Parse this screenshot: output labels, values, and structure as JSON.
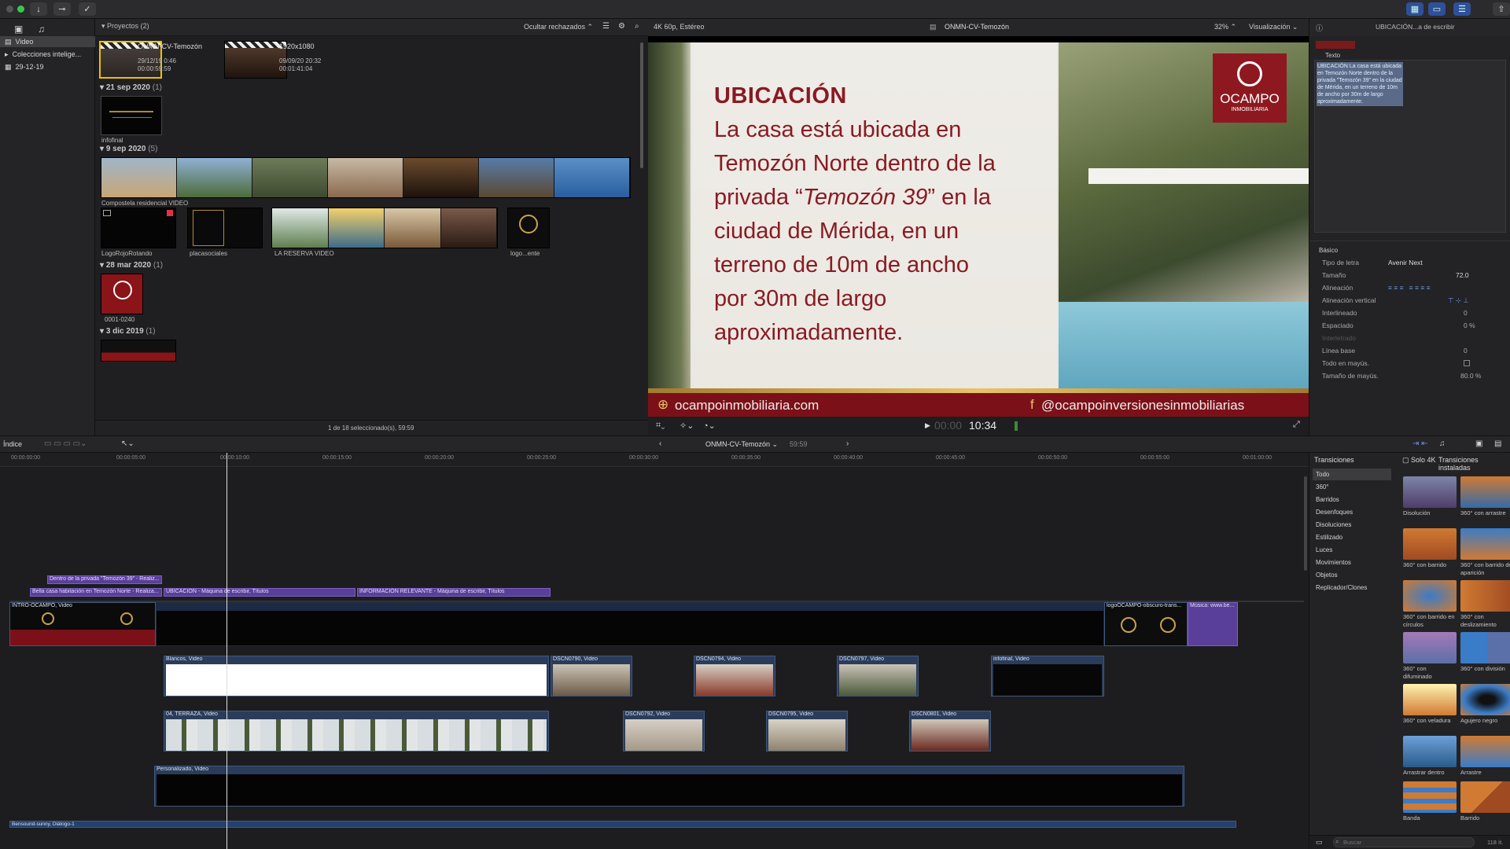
{
  "toolbar": {
    "title": "ONMN-CV-Temozón"
  },
  "sidebar": {
    "items": [
      {
        "label": "Video",
        "selected": true
      },
      {
        "label": "Colecciones intelige..."
      },
      {
        "label": "29-12-19"
      }
    ]
  },
  "browser": {
    "filter_label": "Ocultar rechazados",
    "project_group": "Proyectos",
    "project_count": "(2)",
    "projects": [
      {
        "name": "ONMN-CV-Temozón",
        "date": "29/12/19 0:46",
        "duration": "00:00:59:59"
      },
      {
        "name": "1920x1080",
        "date": "09/09/20 20:32",
        "duration": "00:01:41:04"
      }
    ],
    "groups": [
      {
        "date": "21 sep 2020",
        "count": "(1)",
        "clips": [
          {
            "name": "infofinal"
          }
        ]
      },
      {
        "date": "9 sep 2020",
        "count": "(5)",
        "clips": [
          {
            "name": "Compostela residencial VIDEO"
          },
          {
            "name": "LogoRojoRotando"
          },
          {
            "name": "placasociales"
          },
          {
            "name": "LA RESERVA VIDEO"
          },
          {
            "name": "logo...ente"
          }
        ]
      },
      {
        "date": "28 mar 2020",
        "count": "(1)",
        "clips": [
          {
            "name": "0001-0240"
          }
        ]
      },
      {
        "date": "3 dic 2019",
        "count": "(1)",
        "clips": []
      }
    ],
    "status": "1 de 18 seleccionado(s), 59:59"
  },
  "viewer": {
    "format": "4K 60p, Estéreo",
    "project": "ONMN-CV-Temozón",
    "zoom": "32%",
    "view_menu": "Visualización",
    "timecode_dim": "00:00",
    "timecode": "10:34",
    "frame": {
      "heading": "UBICACIÓN",
      "body_lines": [
        "La casa está ubicada en",
        "Temozón Norte dentro de la",
        "privada “",
        "Temozón 39",
        "” en la",
        "ciudad de Mérida, en un",
        "terreno de 10m de ancho",
        "por 30m de largo",
        "aproximadamente."
      ],
      "logo_word": "OCAMPO",
      "logo_sub": "INMOBILIARIA",
      "website": "ocampoinmobiliaria.com",
      "social": "@ocampoinversionesinmobiliarias"
    }
  },
  "inspector": {
    "header": "UBICACIÓN...a de escribir",
    "section_text": "Texto",
    "text_value": "UBICACIÓN La casa está ubicada en Temozón Norte dentro de la privada \"Temozón 39\" en la ciudad de Mérida, en un terreno de 10m de ancho por 30m de largo aproximadamente.",
    "section_basic": "Básico",
    "rows": [
      {
        "label": "Tipo de letra",
        "value": "Avenir Next"
      },
      {
        "label": "Tamaño",
        "value": "72.0"
      },
      {
        "label": "Alineación",
        "value": ""
      },
      {
        "label": "Alineación vertical",
        "value": ""
      },
      {
        "label": "Interlineado",
        "value": "0"
      },
      {
        "label": "Espaciado",
        "value": "0 %"
      },
      {
        "label": "Interletrado",
        "value": ""
      },
      {
        "label": "Línea base",
        "value": "0"
      },
      {
        "label": "Todo en mayús.",
        "value": ""
      },
      {
        "label": "Tamaño de mayús.",
        "value": "80.0 %"
      }
    ]
  },
  "timeline": {
    "index_label": "Índice",
    "project": "ONMN-CV-Temozón",
    "duration": "59:59",
    "ruler": [
      "00:00:00:00",
      "00:00:05:00",
      "00:00:10:00",
      "00:00:15:00",
      "00:00:20:00",
      "00:00:25:00",
      "00:00:30:00",
      "00:00:35:00",
      "00:00:40:00",
      "00:00:45:00",
      "00:00:50:00",
      "00:00:55:00",
      "00:01:00:00"
    ],
    "titles": [
      {
        "label": "Dentro de la privada \"Temozón 39\" - Realiz..."
      },
      {
        "label": "Bella casa habitación en Temozón Norte - Realiza..."
      },
      {
        "label": "UBICACIÓN - Máquina de escribir, Títulos"
      },
      {
        "label": "INFORMACIÓN RELEVANTE - Máquina de escribir, Títulos"
      }
    ],
    "primary": [
      {
        "label": "INTRO-OCAMPO, Video"
      },
      {
        "label": "logoOCAMPO-obscuro-trans..."
      },
      {
        "label": "Música: www.be..."
      }
    ],
    "conn1": [
      {
        "label": "Blancos, Video"
      },
      {
        "label": "DSCN0790, Video"
      },
      {
        "label": "DSCN0794, Video"
      },
      {
        "label": "DSCN0797, Video"
      },
      {
        "label": "infofinal, Video"
      }
    ],
    "conn2": [
      {
        "label": "04, TERRAZA, Video"
      },
      {
        "label": "DSCN0792, Video"
      },
      {
        "label": "DSCN0795, Video"
      },
      {
        "label": "DSCN0801, Video"
      }
    ],
    "lower": {
      "label": "Personalizado, Video"
    },
    "audio": {
      "label": "Bensound-sunny, Diálogo-1"
    }
  },
  "transitions": {
    "header": "Transiciones",
    "only_installed": "Solo 4K",
    "installed_label": "Transiciones instaladas",
    "categories": [
      "Todo",
      "360°",
      "Barridos",
      "Desenfoques",
      "Disoluciones",
      "Estilizado",
      "Luces",
      "Movimientos",
      "Objetos",
      "Replicador/Clones"
    ],
    "items": [
      {
        "name": "Disolución"
      },
      {
        "name": "360° con arrastre"
      },
      {
        "name": "360° con barrido"
      },
      {
        "name": "360° con barrido de aparición"
      },
      {
        "name": "360° con barrido en círculos"
      },
      {
        "name": "360° con deslizamiento"
      },
      {
        "name": "360° con difuminado"
      },
      {
        "name": "360° con división"
      },
      {
        "name": "360° con veladura"
      },
      {
        "name": "Agujero negro"
      },
      {
        "name": "Arrastrar dentro"
      },
      {
        "name": "Arrastre"
      },
      {
        "name": "Banda"
      },
      {
        "name": "Barrido"
      }
    ],
    "search_placeholder": "Buscar",
    "count": "118 ít."
  }
}
